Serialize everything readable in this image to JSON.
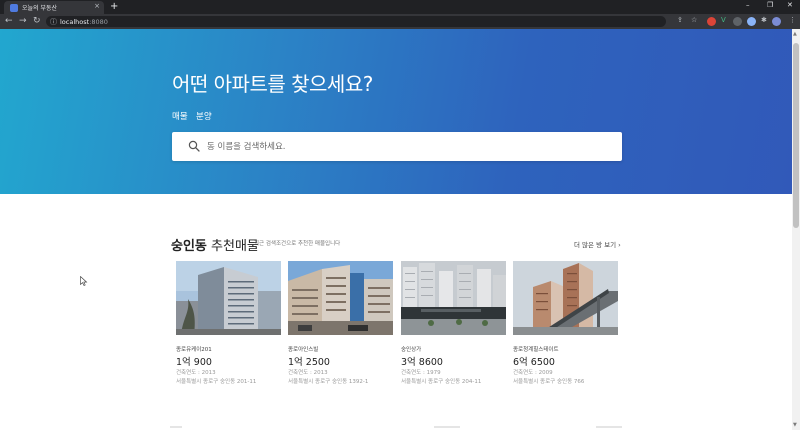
{
  "browser": {
    "tab_title": "오늘의 부동산",
    "tab_close": "×",
    "new_tab": "+",
    "address_host": "localhost",
    "address_port": ":8080",
    "win_min": "–",
    "win_max": "❐",
    "win_close": "✕"
  },
  "hero": {
    "title": "어떤 아파트를 찾으세요?",
    "tabs": [
      "매물",
      "분양"
    ],
    "search_placeholder": "동 이름을 검색하세요."
  },
  "section": {
    "title_bold": "숭인동",
    "title_rest": " 추천매물",
    "subtitle": "최근 검색조건으로 추천한 매물입니다",
    "more_link": "더 많은 방 보기"
  },
  "cards": [
    {
      "name": "종로유케이201",
      "price": "1억 900",
      "year": "건축연도 : 2013",
      "address": "서울특별시 종로구 숭인동 201-11"
    },
    {
      "name": "종로아인스빌",
      "price": "1억 2500",
      "year": "건축연도 : 2013",
      "address": "서울특별시 종로구 숭인동 1392-1"
    },
    {
      "name": "숭인상가",
      "price": "3억 8600",
      "year": "건축연도 : 1979",
      "address": "서울특별시 종로구 숭인동 204-11"
    },
    {
      "name": "종로청계힐스테이트",
      "price": "6억 6500",
      "year": "건축연도 : 2009",
      "address": "서울특별시 종로구 숭인동 766"
    }
  ],
  "colors": {
    "hero_start": "#22a7cf",
    "hero_end": "#3159b9"
  }
}
